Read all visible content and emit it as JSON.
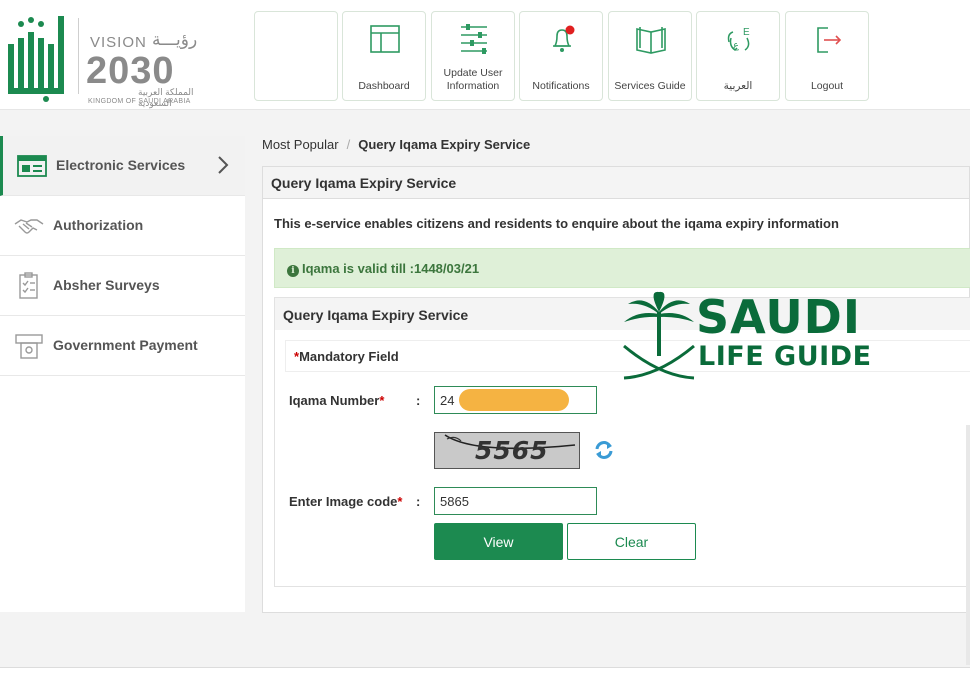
{
  "brand": {
    "vision_en": "VISION",
    "vision_ar": "رؤيـــة",
    "vision_year": "2030",
    "kingdom_ar": "المملكة العربية السعودية",
    "kingdom_en": "KINGDOM OF SAUDI ARABIA",
    "accent_color": "#1c8a50"
  },
  "nav": {
    "items": [
      {
        "label": "",
        "icon": "blank"
      },
      {
        "label": "Dashboard",
        "icon": "dashboard-icon"
      },
      {
        "label": "Update User Information",
        "icon": "sliders-icon"
      },
      {
        "label": "Notifications",
        "icon": "bell-icon"
      },
      {
        "label": "Services Guide",
        "icon": "book-icon"
      },
      {
        "label": "العربية",
        "icon": "language-icon"
      },
      {
        "label": "Logout",
        "icon": "logout-icon"
      }
    ]
  },
  "sidebar": {
    "items": [
      {
        "label": "Electronic Services",
        "icon": "services-icon",
        "active": true
      },
      {
        "label": "Authorization",
        "icon": "handshake-icon"
      },
      {
        "label": "Absher Surveys",
        "icon": "clipboard-icon"
      },
      {
        "label": "Government Payment",
        "icon": "payment-icon"
      }
    ]
  },
  "breadcrumb": {
    "parent": "Most Popular",
    "separator": "/",
    "current": "Query Iqama Expiry Service"
  },
  "panel": {
    "title": "Query Iqama Expiry Service",
    "description": "This e-service enables citizens and residents to enquire about the iqama expiry information",
    "alert": "Iqama is valid till :1448/03/21",
    "alert_icon": "i"
  },
  "form": {
    "title": "Query Iqama Expiry Service",
    "mandatory_asterisk": "*",
    "mandatory_label": "Mandatory Field",
    "iqama_label": "Iqama Number",
    "required_mark": "*",
    "colon": ":",
    "iqama_value": "24",
    "captcha_text": "5565",
    "image_code_label": "Enter Image code",
    "image_code_value": "5865",
    "view_label": "View",
    "clear_label": "Clear"
  },
  "watermark": {
    "line1": "SAUDI",
    "line2": "LIFE GUIDE"
  }
}
